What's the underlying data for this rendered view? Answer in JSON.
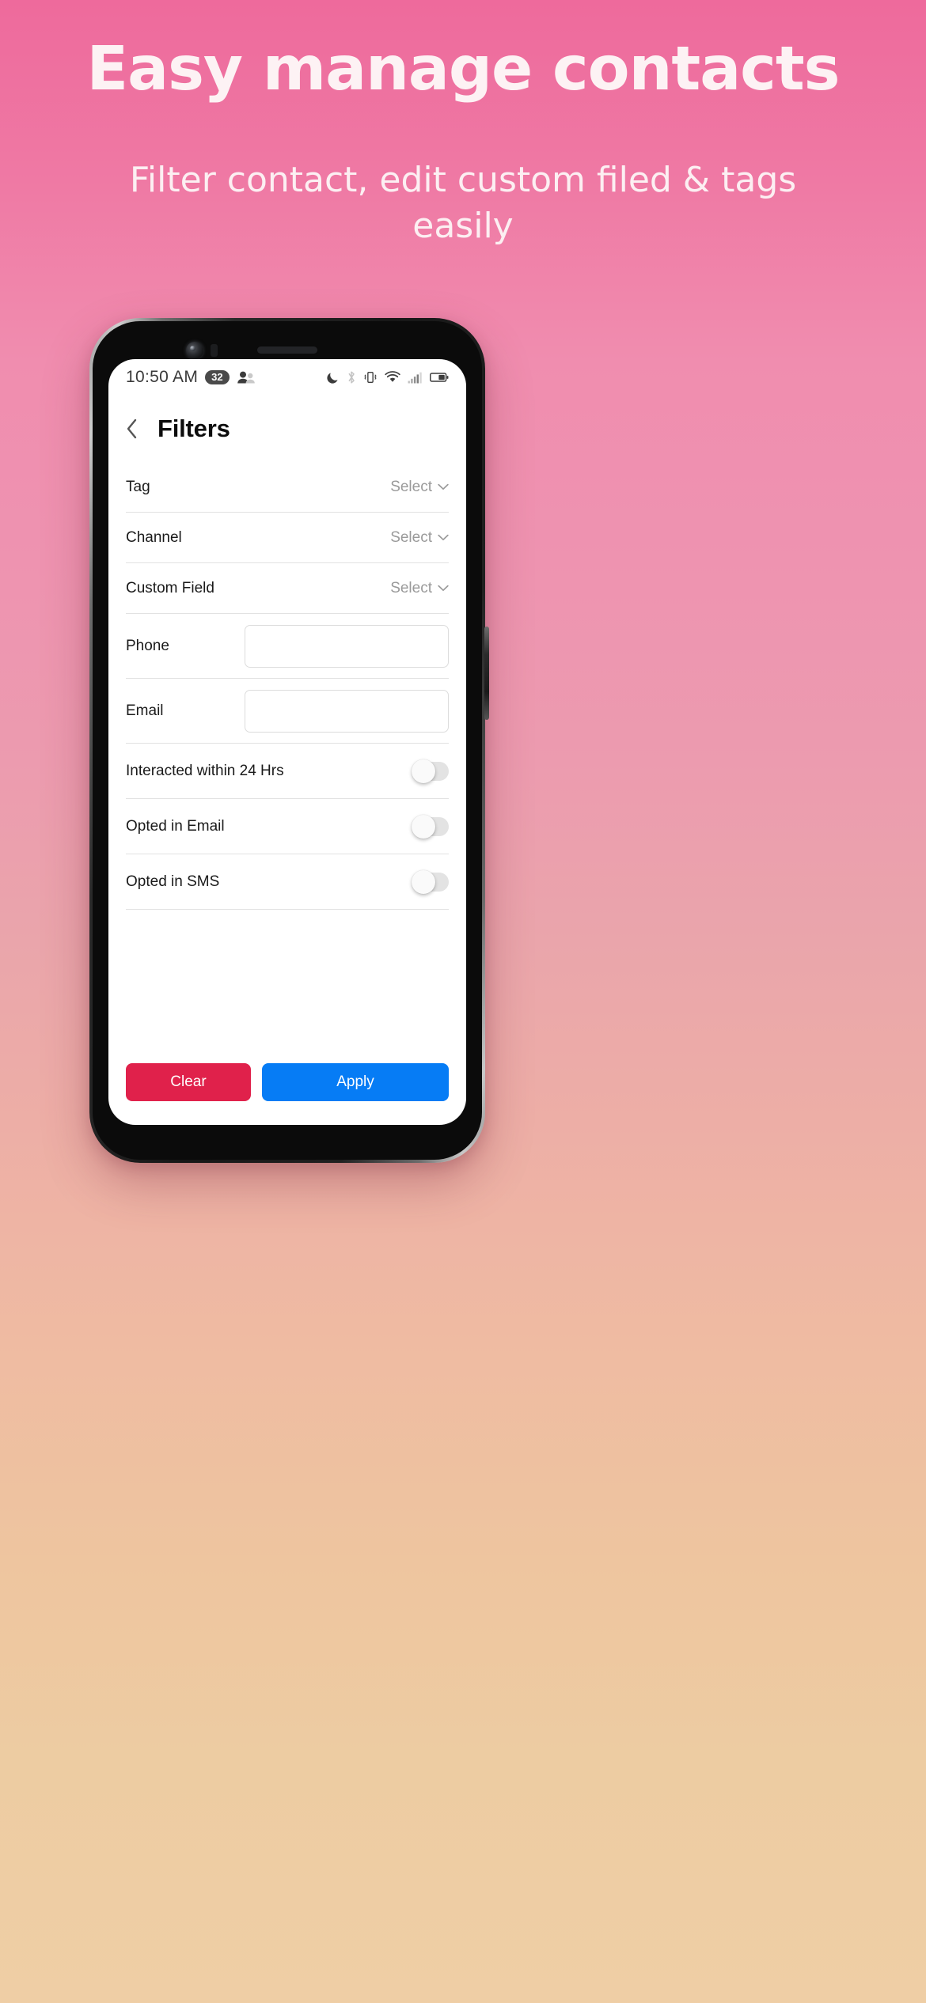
{
  "promo": {
    "title": "Easy manage contacts",
    "subtitle": "Filter contact, edit custom filed & tags easily"
  },
  "colors": {
    "bg_top": "#EE6A9C",
    "bg_bottom": "#EFCEA5",
    "clear_button": "#E0214B",
    "apply_button": "#067CF5",
    "select_text": "#9A9A9A",
    "divider": "#E2E2E2"
  },
  "statusbar": {
    "time": "10:50 AM",
    "badge_count": "32",
    "icons_left": [
      "contacts-people-icon"
    ],
    "icons_right": [
      "do-not-disturb-moon-icon",
      "bluetooth-icon",
      "vibrate-icon",
      "wifi-icon",
      "cellular-signal-icon",
      "battery-icon"
    ]
  },
  "header": {
    "back_icon": "chevron-left-icon",
    "title": "Filters"
  },
  "filters": {
    "select_rows": [
      {
        "label": "Tag",
        "value": "Select"
      },
      {
        "label": "Channel",
        "value": "Select"
      },
      {
        "label": "Custom Field",
        "value": "Select"
      }
    ],
    "input_rows": [
      {
        "label": "Phone",
        "value": "",
        "placeholder": ""
      },
      {
        "label": "Email",
        "value": "",
        "placeholder": ""
      }
    ],
    "toggle_rows": [
      {
        "label": "Interacted within 24 Hrs",
        "state": "off"
      },
      {
        "label": "Opted in Email",
        "state": "off"
      },
      {
        "label": "Opted in SMS",
        "state": "off"
      }
    ]
  },
  "actions": {
    "clear_label": "Clear",
    "apply_label": "Apply"
  }
}
